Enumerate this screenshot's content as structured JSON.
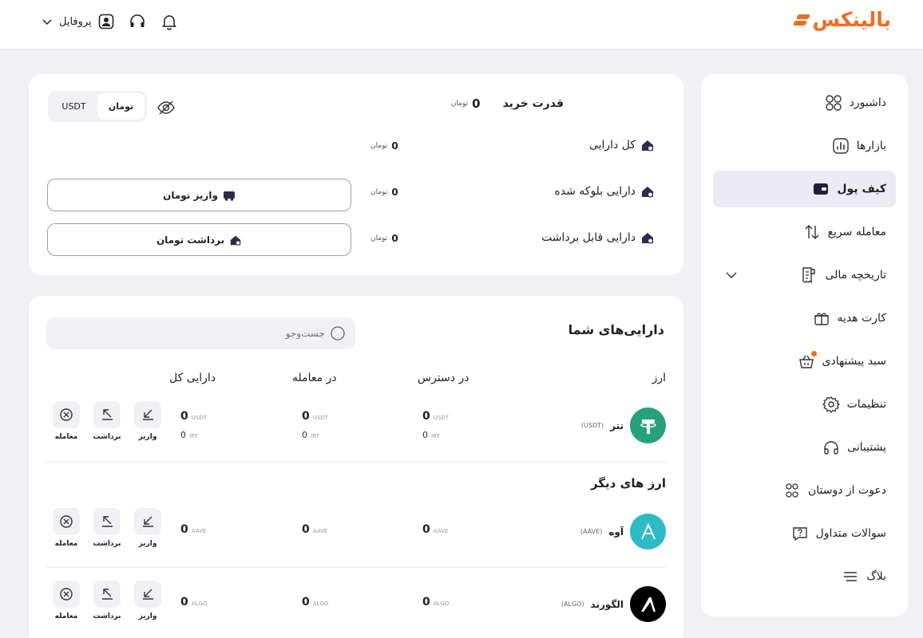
{
  "header": {
    "logo_text": "بالینکس",
    "profile_label": "پروفایل"
  },
  "colors": {
    "accent": "#f16b22",
    "tether": "#26a17b",
    "aave": "#2ebac6",
    "algo": "#000000"
  },
  "sidebar": {
    "items": [
      {
        "label": "داشبورد",
        "icon": "dashboard-grid-icon"
      },
      {
        "label": "بازارها",
        "icon": "markets-chart-icon"
      },
      {
        "label": "کیف پول",
        "icon": "wallet-icon",
        "active": true
      },
      {
        "label": "معامله سریع",
        "icon": "swap-arrows-icon"
      },
      {
        "label": "تاریخچه مالی",
        "icon": "receipt-icon",
        "expandable": true
      },
      {
        "label": "کارت هدیه",
        "icon": "gift-icon"
      },
      {
        "label": "سبد پیشنهادی",
        "icon": "basket-icon",
        "badge_dot": true
      },
      {
        "label": "تنظیمات",
        "icon": "gear-icon"
      },
      {
        "label": "پشتیبانی",
        "icon": "headset-icon"
      },
      {
        "label": "دعوت از دوستان",
        "icon": "invite-users-icon"
      },
      {
        "label": "سوالات متداول",
        "icon": "faq-bubble-icon"
      },
      {
        "label": "بلاگ",
        "icon": "menu-lines-icon"
      }
    ]
  },
  "summary": {
    "buying_power_label": "قدرت خرید",
    "buying_power_value": "0",
    "currency_unit": "تومان",
    "toggle": {
      "toman": "تومان",
      "usdt": "USDT"
    },
    "rows": [
      {
        "label": "کل دارایی",
        "value": "0"
      },
      {
        "label": "دارایی بلوکه شده",
        "value": "0"
      },
      {
        "label": "دارایی قابل برداشت",
        "value": "0"
      }
    ],
    "deposit_button": "واریز تومان",
    "withdraw_button": "برداشت تومان"
  },
  "assets": {
    "title": "دارایی‌های شما",
    "search_placeholder": "جست‌وجو",
    "columns": {
      "currency": "ارز",
      "available": "در دسترس",
      "in_trade": "در معامله",
      "total": "دارایی کل"
    },
    "actions": {
      "deposit": "واریز",
      "withdraw": "برداشت",
      "trade": "معامله"
    },
    "owned": [
      {
        "name": "تتر",
        "code": "(USDT)",
        "unit": "USDT",
        "available": "0",
        "in_trade": "0",
        "total": "0",
        "irt_unit": "IRT",
        "available_irt": "0",
        "in_trade_irt": "0",
        "total_irt": "0"
      }
    ],
    "others_title": "ارز های دیگر",
    "others": [
      {
        "name": "آوه",
        "code": "(AAVE)",
        "unit": "AAVE",
        "available": "0",
        "in_trade": "0",
        "total": "0"
      },
      {
        "name": "الگورند",
        "code": "(ALGO)",
        "unit": "ALGO",
        "available": "0",
        "in_trade": "0",
        "total": "0"
      }
    ]
  }
}
